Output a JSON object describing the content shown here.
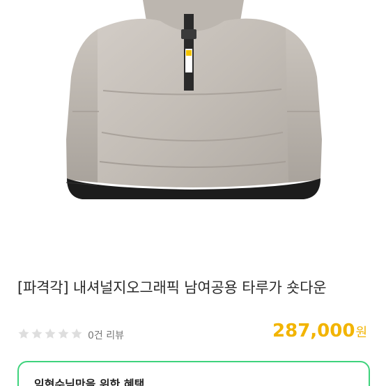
{
  "product": {
    "image_name": "jacket-back-photo",
    "title": "[파격각] 내셔널지오그래픽 남여공용 타루가 숏다운",
    "rating": {
      "stars_total": 5,
      "stars_filled": 0,
      "review_label": "0건 리뷰"
    },
    "price": {
      "amount": "287,000",
      "currency": "원",
      "color": "#f2b400"
    }
  },
  "benefit": {
    "title": "임현수님만을 위한 혜택",
    "border_color": "#3ed37c"
  }
}
